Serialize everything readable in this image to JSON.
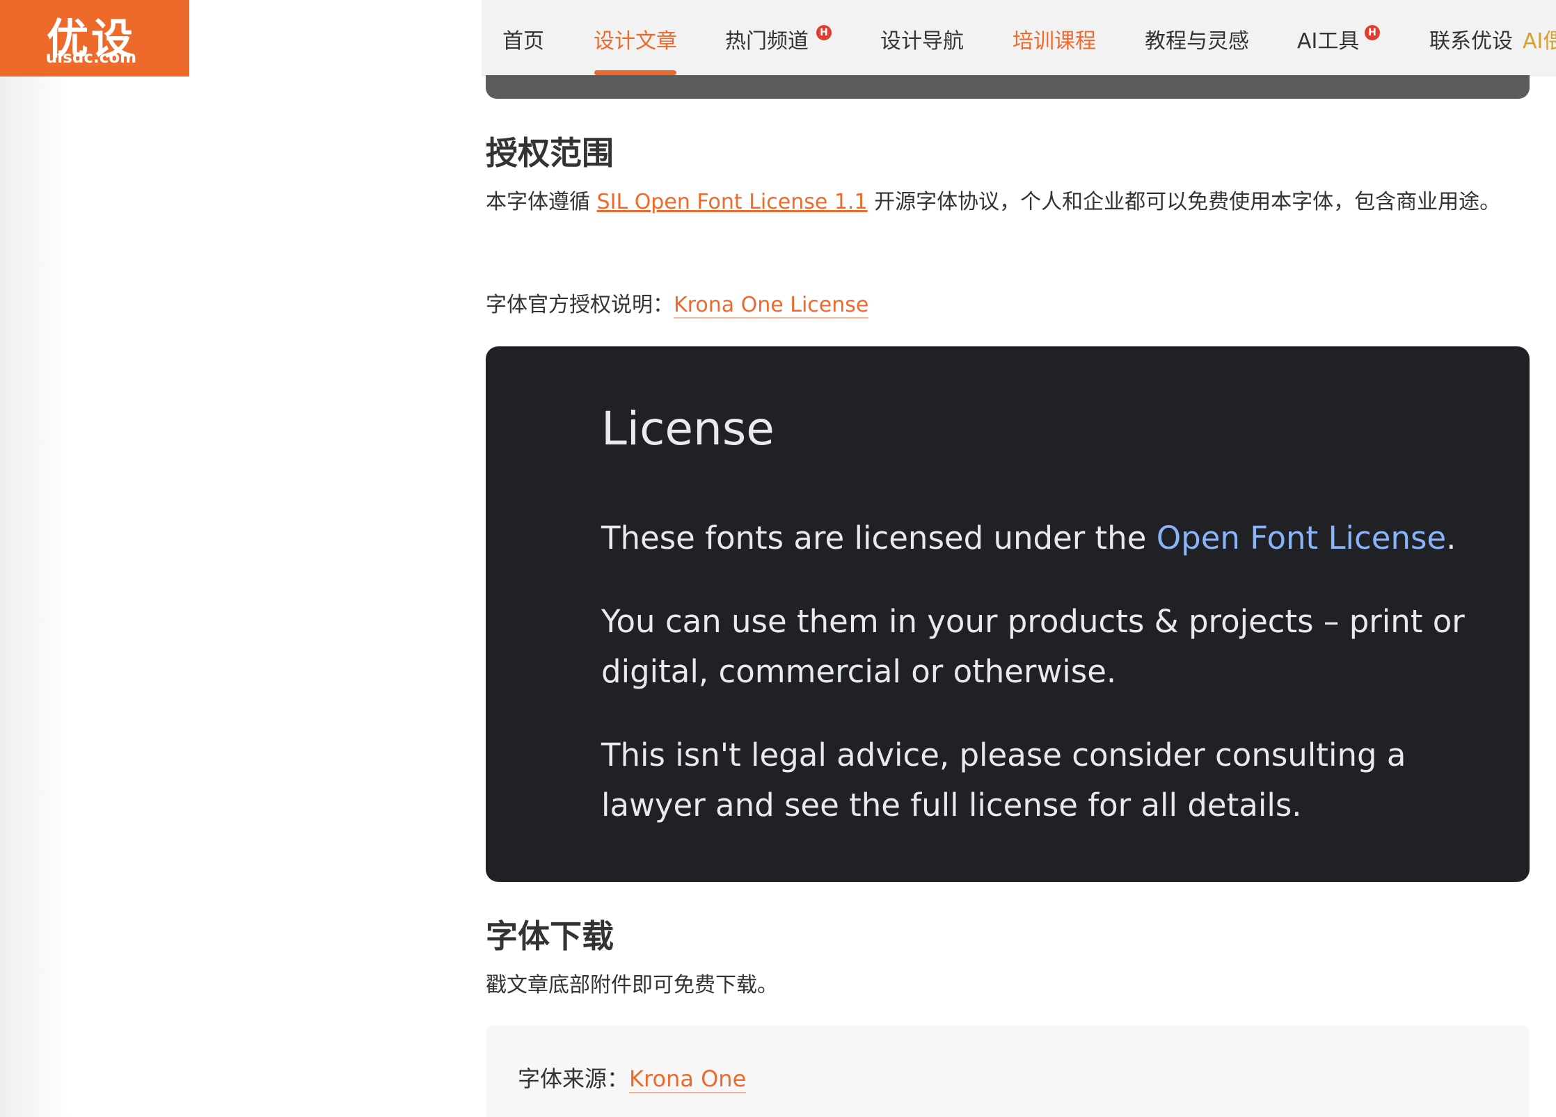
{
  "logo": {
    "cn": "优设",
    "domain": "uisdc.com"
  },
  "nav": {
    "items": [
      {
        "label": "首页"
      },
      {
        "label": "设计文章"
      },
      {
        "label": "热门频道"
      },
      {
        "label": "设计导航"
      },
      {
        "label": "培训课程"
      },
      {
        "label": "教程与灵感"
      },
      {
        "label": "AI工具"
      },
      {
        "label": "联系优设"
      },
      {
        "label": "AI偎"
      }
    ],
    "hot_badge": "H",
    "active_color": "#ee6a2b"
  },
  "license_section": {
    "title": "授权范围",
    "para1_prefix": "本字体遵循 ",
    "para1_link": "SIL Open Font License 1.1",
    "para1_suffix": " 开源字体协议，个人和企业都可以免费使用本字体，包含商业用途。",
    "official_label": "字体官方授权说明：",
    "official_link": "Krona One License"
  },
  "license_image": {
    "title": "License",
    "line1_prefix": "These fonts are licensed under the ",
    "line1_link": "Open Font License",
    "line1_suffix": ".",
    "para2": "You can use them in your products & projects – print or digital, commercial or otherwise.",
    "para3": "This isn't legal advice, please consider consulting a lawyer and see the full license for all details."
  },
  "download_section": {
    "title": "字体下载",
    "text": "戳文章底部附件即可免费下载。"
  },
  "source": {
    "label": "字体来源：",
    "link": "Krona One"
  }
}
